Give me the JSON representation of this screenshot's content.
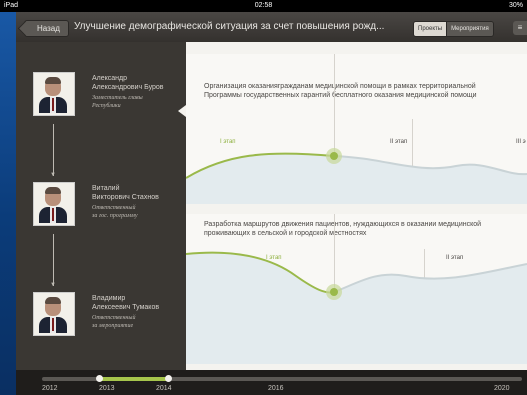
{
  "status_bar": {
    "left": "iPad",
    "time": "02:58",
    "right": "30%"
  },
  "navbar": {
    "back_label": "Назад",
    "title": "Улучшение демографической ситуация за счет повышения рожд...",
    "tabs": [
      "Проекты",
      "Мероприятия"
    ],
    "active_tab": "Проекты"
  },
  "people": [
    {
      "first": "Александр",
      "last": "Александрович Буров",
      "role_lines": [
        "Заместитель главы",
        "Республики"
      ]
    },
    {
      "first": "Виталий",
      "last": "Викторович Стахнов",
      "role_lines": [
        "Ответственный",
        "за гос. программу"
      ]
    },
    {
      "first": "Владимир",
      "last": "Алексеевич Тумаков",
      "role_lines": [
        "Ответственный",
        "за мероприятие"
      ]
    }
  ],
  "cards": [
    {
      "text_lines": [
        "Организация оказаниягражданам медицинской помощи в рамках территориальной",
        "Программы государственных гарантий бесплатного оказания медицинской помощи"
      ],
      "stages": [
        "I этап",
        "II этап",
        "III э"
      ]
    },
    {
      "text_lines": [
        "Разработка маршрутов движения пациентов, нуждающихся в оказании медицинской",
        "проживающих в сельской и городской местностях"
      ],
      "stages": [
        "I этап",
        "II этап"
      ]
    }
  ],
  "timeline": {
    "years": [
      "2012",
      "2013",
      "2014",
      "2016",
      "2020"
    ],
    "accent": "#a6c54c"
  },
  "colors": {
    "accent_green": "#8db03e",
    "panel_dark": "#3a3733"
  }
}
